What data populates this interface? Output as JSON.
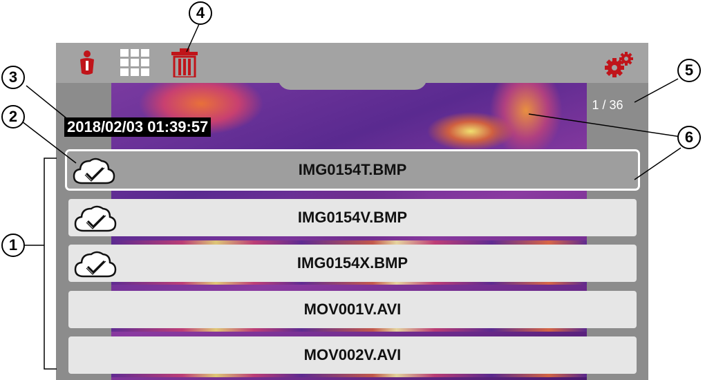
{
  "toolbar": {
    "icons": [
      "info-icon",
      "grid-icon",
      "trash-icon",
      "settings-gears-icon"
    ],
    "accent_color": "#c0141a"
  },
  "image_counter": "1 / 36",
  "timestamp": "2018/02/03 01:39:57",
  "files": [
    {
      "name": "IMG0154T.BMP",
      "cloud_uploaded": true,
      "selected": true
    },
    {
      "name": "IMG0154V.BMP",
      "cloud_uploaded": true,
      "selected": false
    },
    {
      "name": "IMG0154X.BMP",
      "cloud_uploaded": true,
      "selected": false
    },
    {
      "name": "MOV001V.AVI",
      "cloud_uploaded": false,
      "selected": false
    },
    {
      "name": "MOV002V.AVI",
      "cloud_uploaded": false,
      "selected": false
    }
  ],
  "callouts": [
    "1",
    "2",
    "3",
    "4",
    "5",
    "6"
  ]
}
